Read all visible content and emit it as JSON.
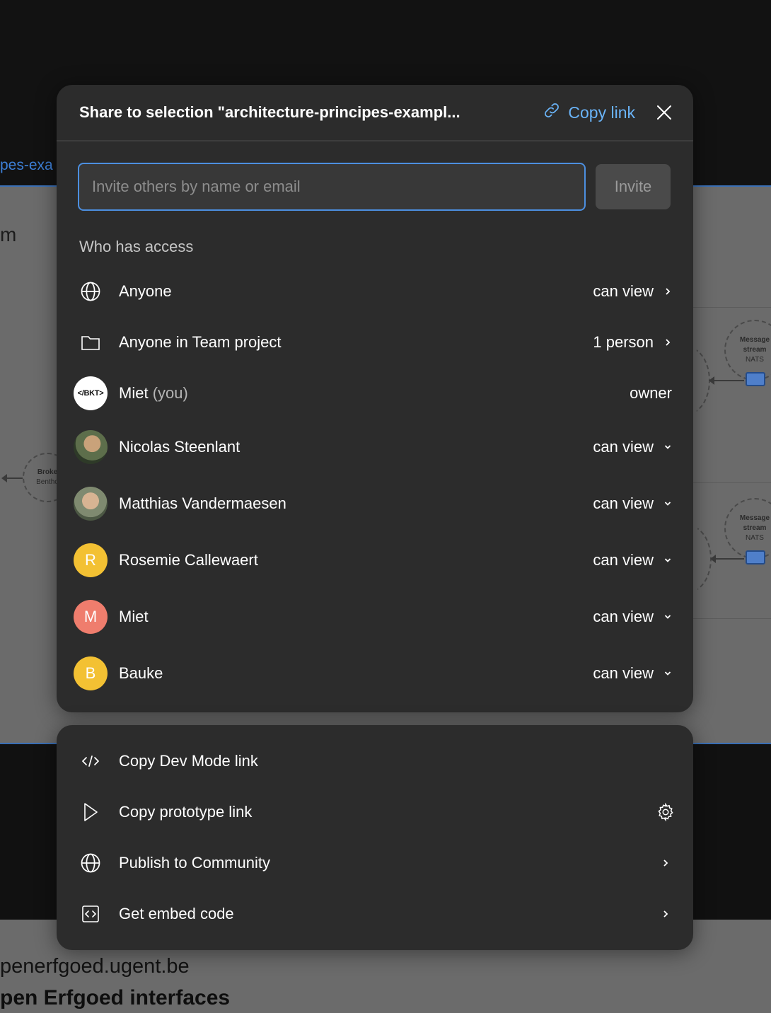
{
  "background": {
    "tab_fragment": "pes-exa",
    "heading_fragment": "m",
    "url_fragment": "penerfgoed.ugent.be",
    "footer_title_fragment": "pen Erfgoed interfaces",
    "nodes": [
      {
        "title": "Message",
        "line2": "stream",
        "sub": "NATS"
      },
      {
        "title": "Message",
        "line2": "stream",
        "sub": "NATS"
      },
      {
        "title": "Broke",
        "sub": "Bentho"
      }
    ]
  },
  "share": {
    "title": "Share to selection \"architecture-principes-exampl...",
    "copy_link_label": "Copy link",
    "invite_placeholder": "Invite others by name or email",
    "invite_button": "Invite",
    "access_heading": "Who has access",
    "general_access": [
      {
        "icon": "globe-icon",
        "name": "Anyone",
        "permission": "can view"
      },
      {
        "icon": "folder-icon",
        "name": "Anyone in Team project",
        "permission": "1 person"
      }
    ],
    "owner": {
      "avatar_text": "</BKT>",
      "name": "Miet",
      "suffix": "(you)",
      "permission": "owner"
    },
    "members": [
      {
        "name": "Nicolas Steenlant",
        "permission": "can view",
        "avatar_text": ""
      },
      {
        "name": "Matthias Vandermaesen",
        "permission": "can view",
        "avatar_text": ""
      },
      {
        "name": "Rosemie Callewaert",
        "permission": "can view",
        "avatar_text": "R"
      },
      {
        "name": "Miet",
        "permission": "can view",
        "avatar_text": "M"
      },
      {
        "name": "Bauke",
        "permission": "can view",
        "avatar_text": "B"
      }
    ]
  },
  "actions": [
    {
      "icon": "code-icon",
      "label": "Copy Dev Mode link",
      "trail": ""
    },
    {
      "icon": "play-icon",
      "label": "Copy prototype link",
      "trail": "gear-icon"
    },
    {
      "icon": "globe-icon",
      "label": "Publish to Community",
      "trail": "chevron-right-icon"
    },
    {
      "icon": "embed-icon",
      "label": "Get embed code",
      "trail": "chevron-right-icon"
    }
  ],
  "colors": {
    "accent": "#6ab4f8",
    "modal_bg": "#2c2c2c",
    "input_border": "#4c8fe0",
    "avatar_yellow": "#f3c133",
    "avatar_salmon": "#ef7d6d"
  }
}
